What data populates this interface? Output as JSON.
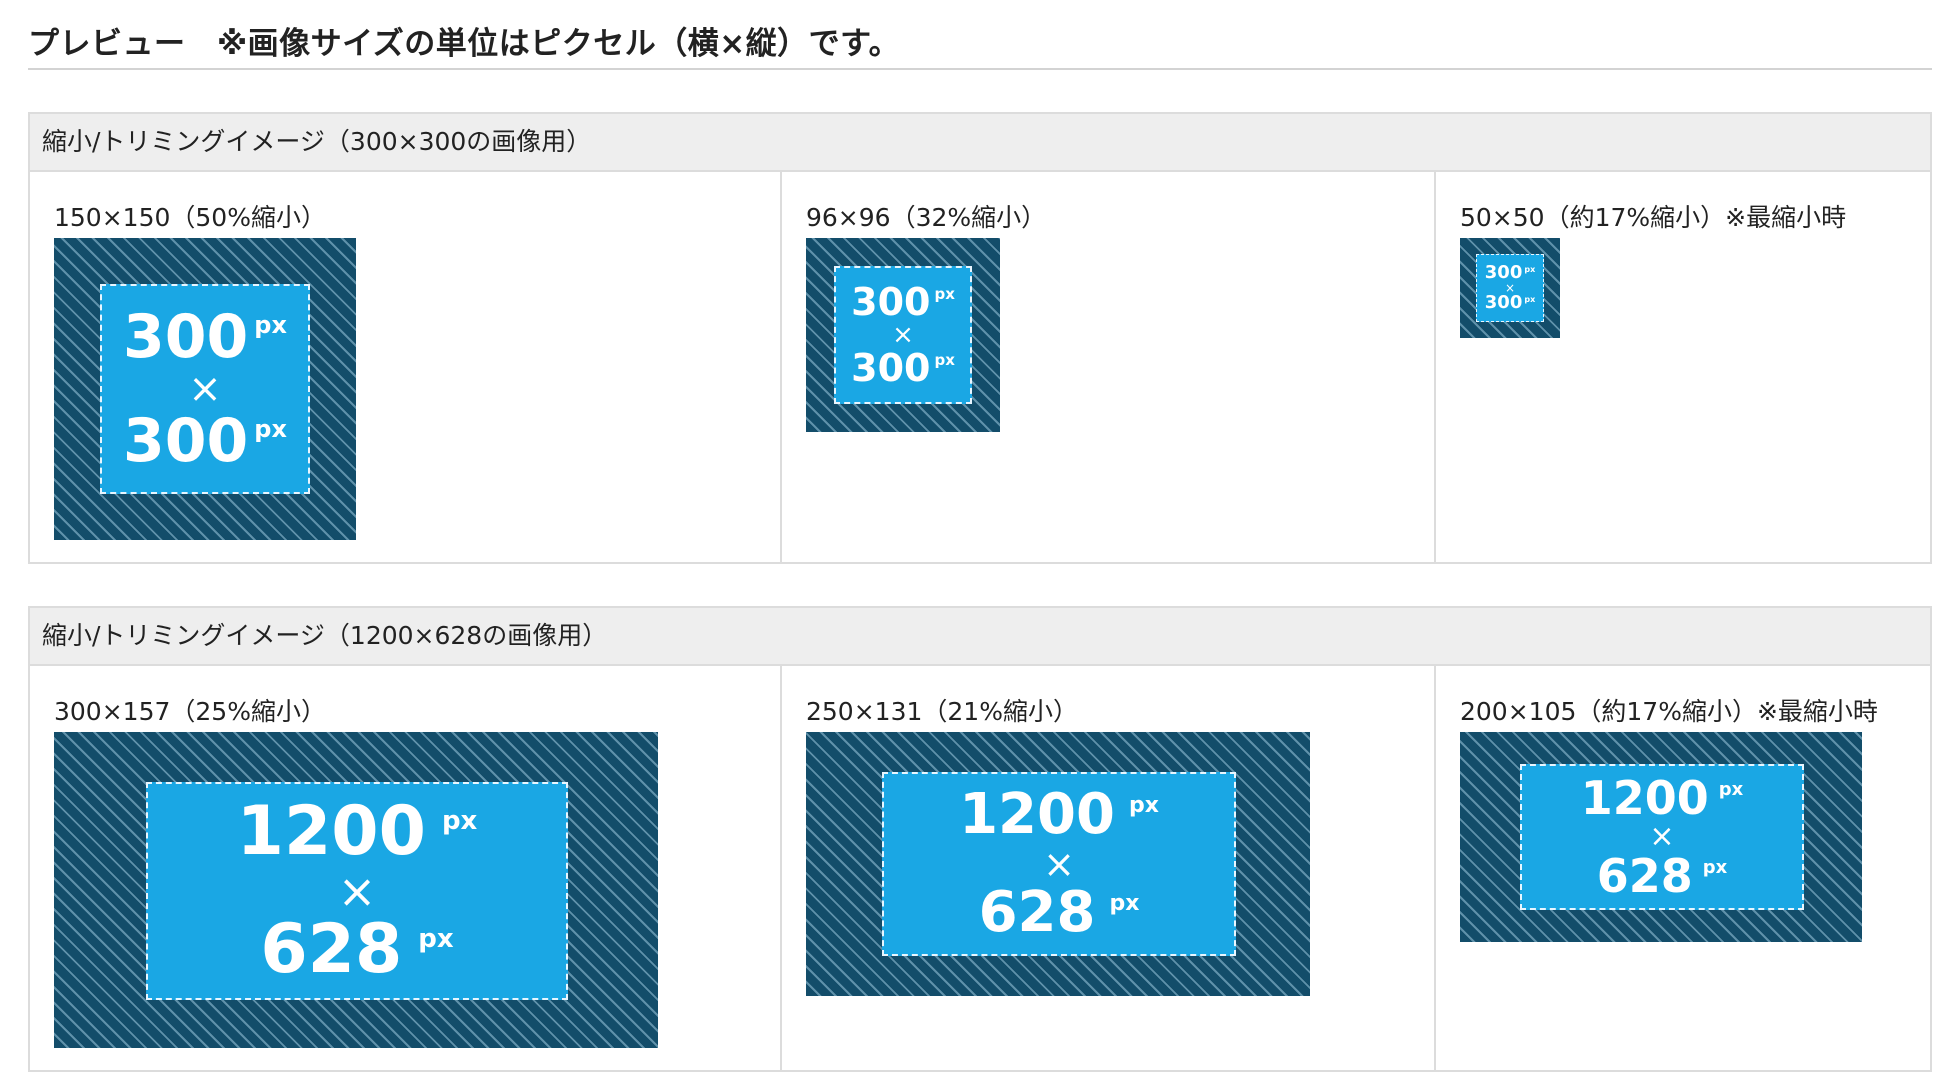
{
  "title": "プレビュー　※画像サイズの単位はピクセル（横×縦）です。",
  "sections": [
    {
      "header": "縮小/トリミングイメージ（300×300の画像用）",
      "cells": [
        {
          "label": "150×150（50%縮小）",
          "w": "300",
          "h": "300",
          "unit": "px",
          "times": "×"
        },
        {
          "label": "96×96（32%縮小）",
          "w": "300",
          "h": "300",
          "unit": "px",
          "times": "×"
        },
        {
          "label": "50×50（約17%縮小）※最縮小時",
          "w": "300",
          "h": "300",
          "unit": "px",
          "times": "×"
        }
      ]
    },
    {
      "header": "縮小/トリミングイメージ（1200×628の画像用）",
      "cells": [
        {
          "label": "300×157（25%縮小）",
          "w": "1200",
          "h": "628",
          "unit": "px",
          "times": "×"
        },
        {
          "label": "250×131（21%縮小）",
          "w": "1200",
          "h": "628",
          "unit": "px",
          "times": "×"
        },
        {
          "label": "200×105（約17%縮小）※最縮小時",
          "w": "1200",
          "h": "628",
          "unit": "px",
          "times": "×"
        }
      ]
    }
  ],
  "colors": {
    "outer_frame": "#134d6a",
    "stripe": "#5f91aa",
    "safe_area": "#1aa7e4",
    "header_bg": "#eeeeee",
    "border": "#dcdcdc"
  }
}
